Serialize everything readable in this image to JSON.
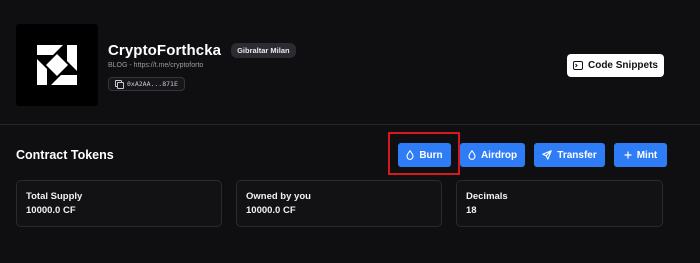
{
  "profile": {
    "title": "CryptoForthcka",
    "badge": "Gibraltar Milan",
    "blog": "BLOG - https://t.me/cryptoforto",
    "address": "0xA2AA...871E",
    "logo_icon": "pinwheel-logo-icon"
  },
  "header": {
    "snippets_label": "Code Snippets",
    "snippets_icon": "terminal-icon"
  },
  "section": {
    "title": "Contract Tokens"
  },
  "actions": {
    "burn": "Burn",
    "airdrop": "Airdrop",
    "transfer": "Transfer",
    "mint": "Mint"
  },
  "stats": [
    {
      "label": "Total Supply",
      "value": "10000.0 CF"
    },
    {
      "label": "Owned by you",
      "value": "10000.0 CF"
    },
    {
      "label": "Decimals",
      "value": "18"
    }
  ],
  "colors": {
    "background": "#0f0f11",
    "accent": "#2f7df6",
    "highlight": "#d6191d"
  }
}
